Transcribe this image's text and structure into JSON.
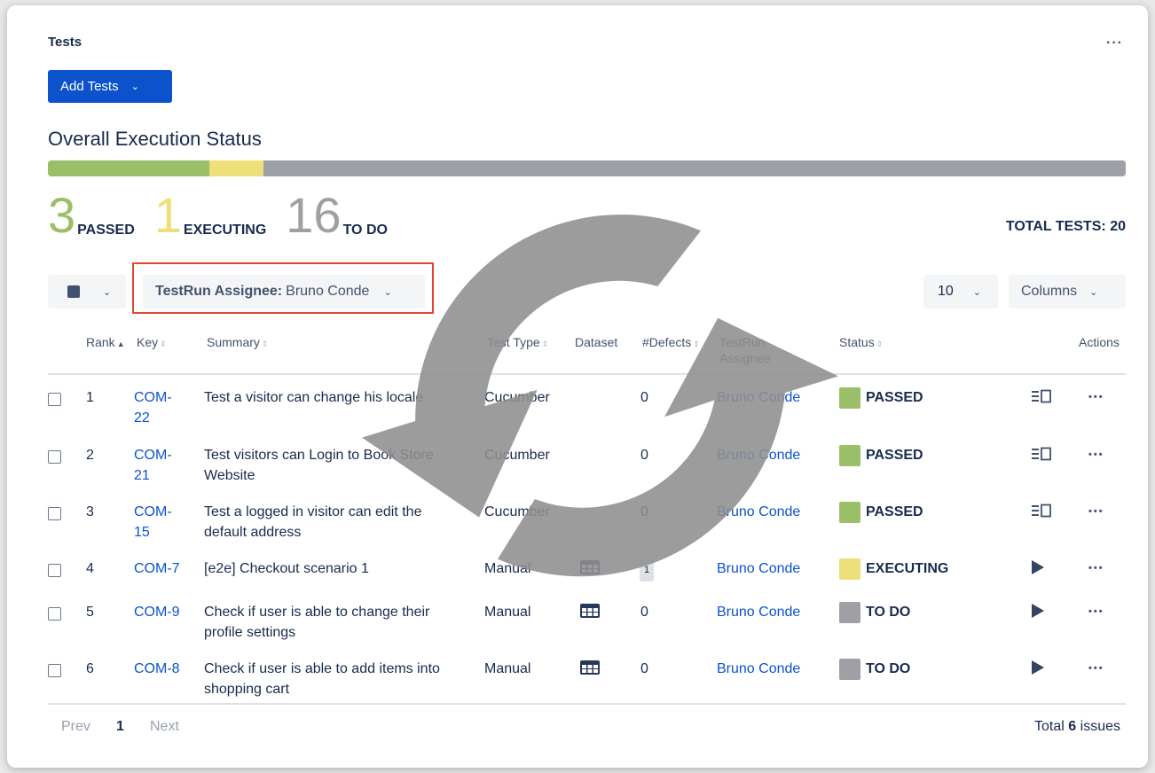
{
  "header": {
    "title": "Tests",
    "more": "···",
    "add_button": "Add Tests"
  },
  "execution": {
    "heading": "Overall Execution Status",
    "segments": [
      {
        "label": "PASSED",
        "count": 3,
        "color": "#9bbf69"
      },
      {
        "label": "EXECUTING",
        "count": 1,
        "color": "#ede07a"
      },
      {
        "label": "TO DO",
        "count": 16,
        "color": "#9fa0a5"
      }
    ],
    "counts": {
      "passed": "3",
      "passed_label": "PASSED",
      "executing": "1",
      "executing_label": "EXECUTING",
      "todo": "16",
      "todo_label": "TO DO"
    },
    "total_label": "TOTAL TESTS: 20"
  },
  "toolbar": {
    "filter_label": "TestRun Assignee:",
    "filter_value": "Bruno Conde",
    "per_page": "10",
    "columns": "Columns",
    "highlight_color": "#e4472f"
  },
  "table": {
    "headers": {
      "rank": "Rank",
      "key": "Key",
      "summary": "Summary",
      "test_type": "Test Type",
      "dataset": "Dataset",
      "defects": "#Defects",
      "assignee": "TestRun Assignee",
      "status": "Status",
      "actions": "Actions"
    },
    "rows": [
      {
        "rank": "1",
        "key": "COM-22",
        "summary": "Test a visitor can change his locale",
        "type": "Cucumber",
        "dataset": "",
        "defects": "0",
        "assignee": "Bruno Conde",
        "status": "PASSED",
        "status_color": "#9bbf69",
        "action_icon": "execution-details-icon"
      },
      {
        "rank": "2",
        "key": "COM-21",
        "summary": "Test visitors can Login to Book Store Website",
        "type": "Cucumber",
        "dataset": "",
        "defects": "0",
        "assignee": "Bruno Conde",
        "status": "PASSED",
        "status_color": "#9bbf69",
        "action_icon": "execution-details-icon"
      },
      {
        "rank": "3",
        "key": "COM-15",
        "summary": "Test a logged in visitor can edit the default address",
        "type": "Cucumber",
        "dataset": "",
        "defects": "0",
        "assignee": "Bruno Conde",
        "status": "PASSED",
        "status_color": "#9bbf69",
        "action_icon": "execution-details-icon"
      },
      {
        "rank": "4",
        "key": "COM-7",
        "summary": "[e2e] Checkout scenario 1",
        "type": "Manual",
        "dataset": "table-icon",
        "defects": "1",
        "assignee": "Bruno Conde",
        "status": "EXECUTING",
        "status_color": "#ede07a",
        "action_icon": "play-icon"
      },
      {
        "rank": "5",
        "key": "COM-9",
        "summary": "Check if user is able to change their profile settings",
        "type": "Manual",
        "dataset": "table-icon",
        "defects": "0",
        "assignee": "Bruno Conde",
        "status": "TO DO",
        "status_color": "#9fa0a5",
        "action_icon": "play-icon"
      },
      {
        "rank": "6",
        "key": "COM-8",
        "summary": "Check if user is able to add items into shopping cart",
        "type": "Manual",
        "dataset": "table-icon",
        "defects": "0",
        "assignee": "Bruno Conde",
        "status": "TO DO",
        "status_color": "#9fa0a5",
        "action_icon": "play-icon"
      }
    ]
  },
  "pagination": {
    "prev": "Prev",
    "page": "1",
    "next": "Next",
    "total_prefix": "Total",
    "total_count": "6",
    "total_suffix": "issues"
  },
  "overlay": {
    "icon": "refresh-icon",
    "color": "#8e8e90"
  }
}
